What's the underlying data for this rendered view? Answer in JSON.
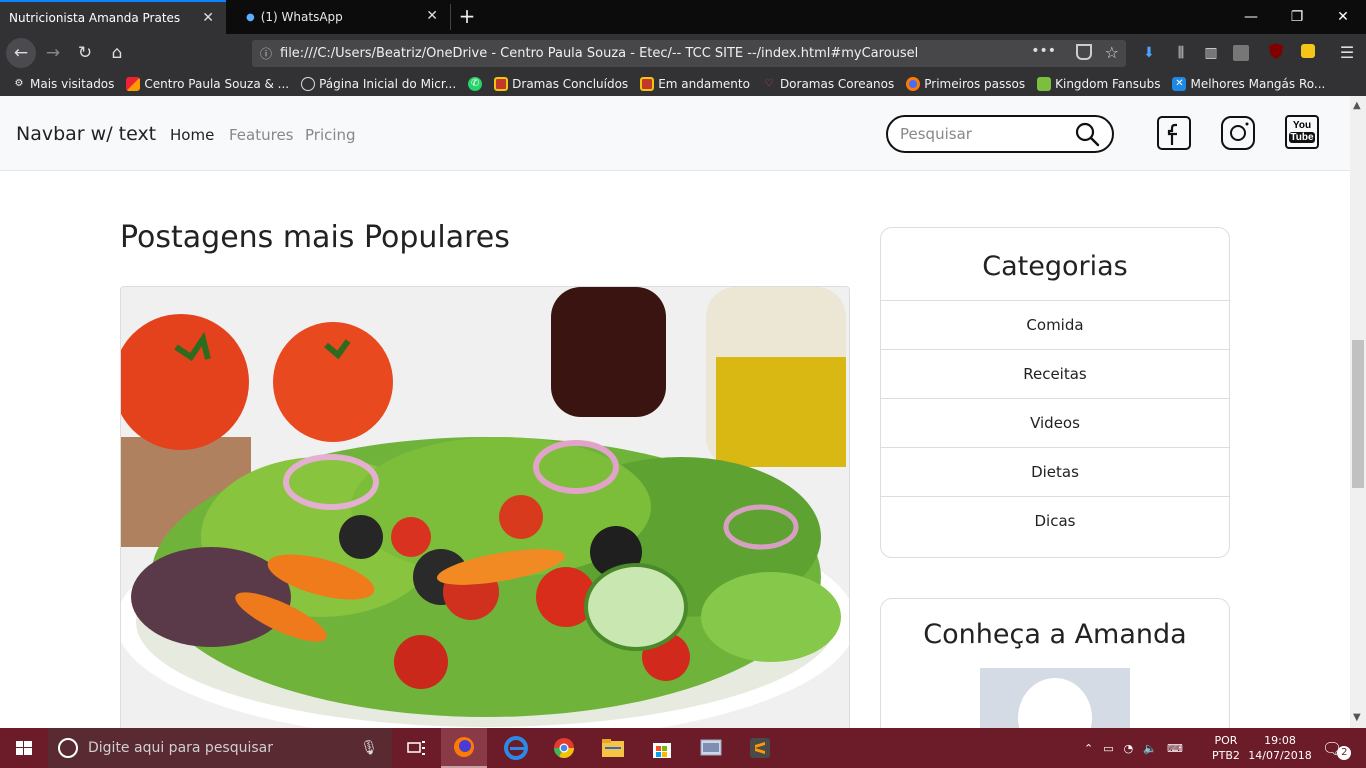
{
  "browser": {
    "tabs": [
      {
        "title": "Nutricionista Amanda Prates",
        "active": true
      },
      {
        "title": "(1) WhatsApp",
        "active": false
      }
    ],
    "url": "file:///C:/Users/Beatriz/OneDrive - Centro Paula Souza - Etec/-- TCC SITE --/index.html#myCarousel",
    "bookmarks": [
      {
        "label": "Mais visitados",
        "icon": "gear-icon"
      },
      {
        "label": "Centro Paula Souza & ...",
        "icon": "cps-icon"
      },
      {
        "label": "Página Inicial do Micr...",
        "icon": "globe-icon"
      },
      {
        "label": "",
        "icon": "whatsapp-icon"
      },
      {
        "label": "Dramas Concluídos",
        "icon": "drama-icon"
      },
      {
        "label": "Em andamento",
        "icon": "drama-icon"
      },
      {
        "label": "Doramas Coreanos",
        "icon": "heart-icon"
      },
      {
        "label": "Primeiros passos",
        "icon": "firefox-icon"
      },
      {
        "label": "Kingdom Fansubs",
        "icon": "chat-icon"
      },
      {
        "label": "Melhores Mangás Ro...",
        "icon": "x-icon"
      }
    ]
  },
  "site": {
    "brand": "Navbar w/ text",
    "nav": {
      "home": "Home",
      "features": "Features",
      "pricing": "Pricing"
    },
    "search_placeholder": "Pesquisar",
    "social": [
      "facebook-icon",
      "instagram-icon",
      "youtube-icon"
    ],
    "youtube_label_top": "You",
    "youtube_label_bottom": "Tube",
    "posts_title": "Postagens mais Populares",
    "categories": {
      "title": "Categorias",
      "items": [
        "Comida",
        "Receitas",
        "Videos",
        "Dietas",
        "Dicas"
      ]
    },
    "about": {
      "title": "Conheça a Amanda"
    }
  },
  "taskbar": {
    "search_placeholder": "Digite aqui para pesquisar",
    "language_top": "POR",
    "language_bottom": "PTB2",
    "time": "19:08",
    "date": "14/07/2018",
    "notifications": "2"
  },
  "colors": {
    "accent": "#0a84ff",
    "taskbar": "#6b1c28",
    "browser_chrome": "#323234"
  }
}
